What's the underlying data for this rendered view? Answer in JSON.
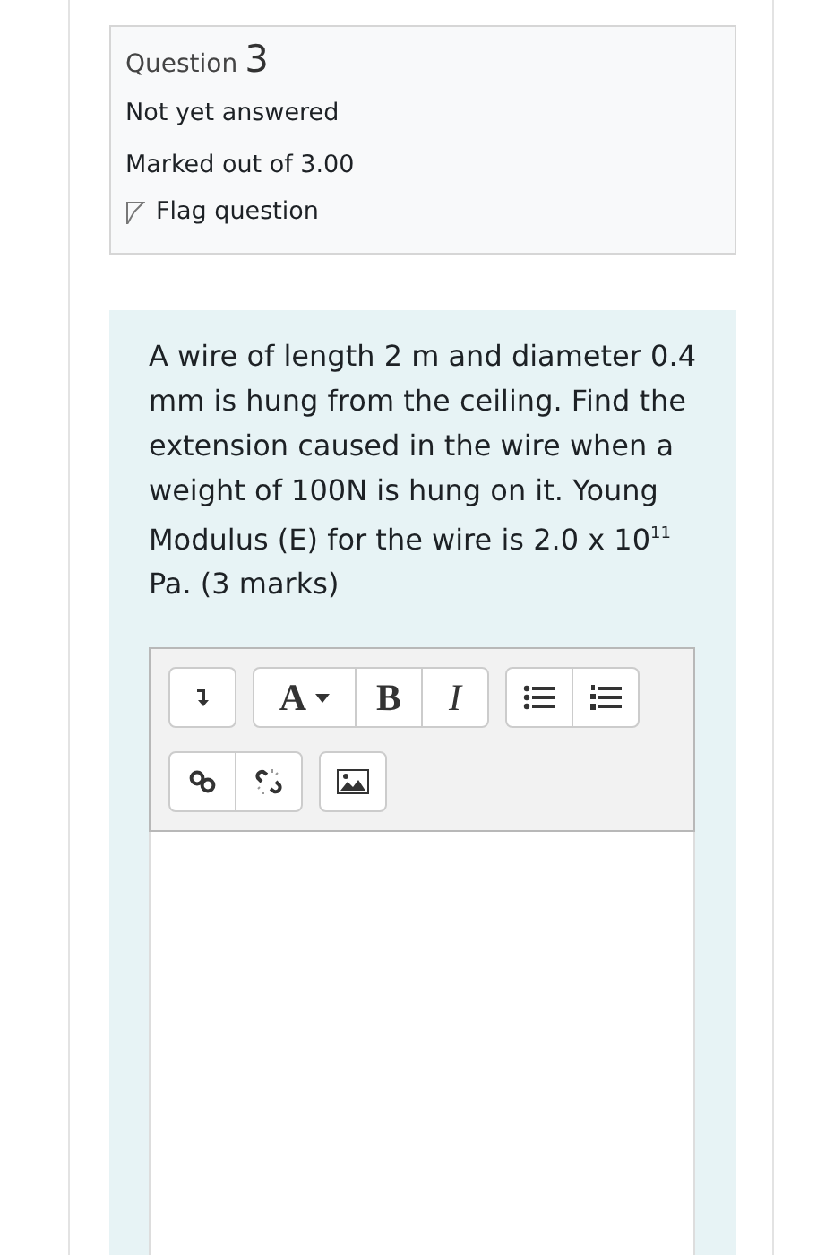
{
  "info": {
    "label": "Question",
    "number": "3",
    "state": "Not yet answered",
    "marks": "Marked out of 3.00",
    "flag": "Flag question"
  },
  "question_text": "A wire of length 2 m and diameter 0.4 mm is hung from the ceiling. Find the extension caused in the wire when a weight of 100N is hung on it. Young Modulus (E) for the wire is 2.0 x 10$^{11}$ Pa. (3 marks)",
  "toolbar": [
    [
      [
        {
          "kind": "collapse"
        }
      ],
      [
        {
          "kind": "font",
          "label": "A"
        },
        {
          "kind": "bold",
          "label": "B"
        },
        {
          "kind": "italic",
          "label": "I"
        }
      ],
      [
        {
          "kind": "bullets"
        },
        {
          "kind": "numbers"
        }
      ]
    ],
    [
      [
        {
          "kind": "link"
        },
        {
          "kind": "unlink"
        }
      ],
      [
        {
          "kind": "image"
        }
      ]
    ]
  ]
}
